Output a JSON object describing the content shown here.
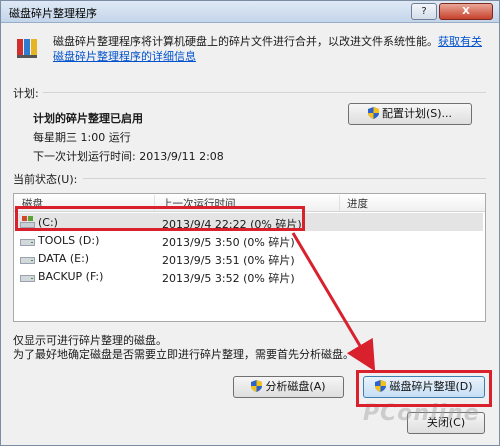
{
  "window": {
    "title": "磁盘碎片整理程序",
    "help_label": "?",
    "close_label": "X"
  },
  "intro": {
    "text": "磁盘碎片整理程序将计算机硬盘上的碎片文件进行合并，以改进文件系统性能。",
    "link": "获取有关磁盘碎片整理程序的详细信息"
  },
  "schedule": {
    "section_label": "计划:",
    "status": "计划的碎片整理已启用",
    "when": "每星期三 1:00 运行",
    "next_run": "下一次计划运行时间: 2013/9/11 2:08",
    "configure_button": "配置计划(S)..."
  },
  "disks": {
    "section_label": "当前状态(U):",
    "columns": [
      "磁盘",
      "上一次运行时间",
      "进度"
    ],
    "rows": [
      {
        "name": "(C:)",
        "last_run": "2013/9/4 22:22 (0% 碎片)",
        "progress": "",
        "selected": true
      },
      {
        "name": "TOOLS (D:)",
        "last_run": "2013/9/5 3:50 (0% 碎片)",
        "progress": "",
        "selected": false
      },
      {
        "name": "DATA (E:)",
        "last_run": "2013/9/5 3:51 (0% 碎片)",
        "progress": "",
        "selected": false
      },
      {
        "name": "BACKUP (F:)",
        "last_run": "2013/9/5 3:52 (0% 碎片)",
        "progress": "",
        "selected": false
      }
    ]
  },
  "footer": {
    "note1": "仅显示可进行碎片整理的磁盘。",
    "note2": "为了最好地确定磁盘是否需要立即进行碎片整理，需要首先分析磁盘。",
    "analyze_button": "分析磁盘(A)",
    "defrag_button": "磁盘碎片整理(D)",
    "close_button": "关闭(C)"
  },
  "watermark": "PConline",
  "colors": {
    "highlight": "#d9202d",
    "link": "#0052cc",
    "selected_row": "#e4e4e4"
  }
}
